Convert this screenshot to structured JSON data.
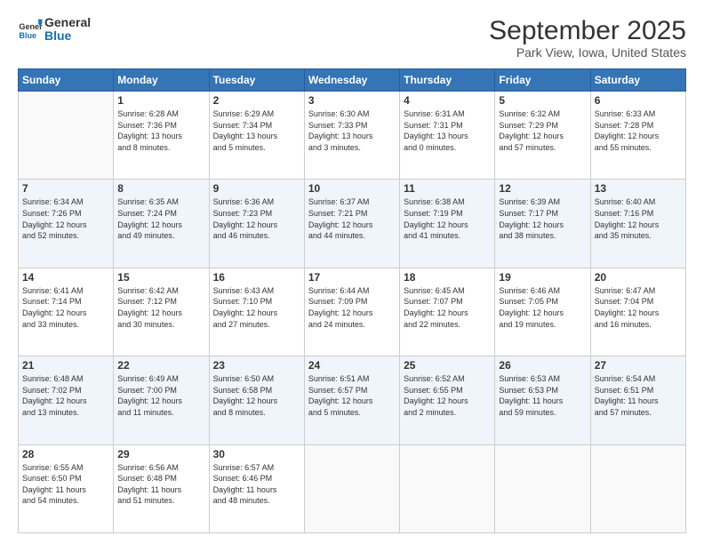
{
  "header": {
    "logo_line1": "General",
    "logo_line2": "Blue",
    "title": "September 2025",
    "subtitle": "Park View, Iowa, United States"
  },
  "days_of_week": [
    "Sunday",
    "Monday",
    "Tuesday",
    "Wednesday",
    "Thursday",
    "Friday",
    "Saturday"
  ],
  "weeks": [
    [
      {
        "day": "",
        "info": ""
      },
      {
        "day": "1",
        "info": "Sunrise: 6:28 AM\nSunset: 7:36 PM\nDaylight: 13 hours\nand 8 minutes."
      },
      {
        "day": "2",
        "info": "Sunrise: 6:29 AM\nSunset: 7:34 PM\nDaylight: 13 hours\nand 5 minutes."
      },
      {
        "day": "3",
        "info": "Sunrise: 6:30 AM\nSunset: 7:33 PM\nDaylight: 13 hours\nand 3 minutes."
      },
      {
        "day": "4",
        "info": "Sunrise: 6:31 AM\nSunset: 7:31 PM\nDaylight: 13 hours\nand 0 minutes."
      },
      {
        "day": "5",
        "info": "Sunrise: 6:32 AM\nSunset: 7:29 PM\nDaylight: 12 hours\nand 57 minutes."
      },
      {
        "day": "6",
        "info": "Sunrise: 6:33 AM\nSunset: 7:28 PM\nDaylight: 12 hours\nand 55 minutes."
      }
    ],
    [
      {
        "day": "7",
        "info": "Sunrise: 6:34 AM\nSunset: 7:26 PM\nDaylight: 12 hours\nand 52 minutes."
      },
      {
        "day": "8",
        "info": "Sunrise: 6:35 AM\nSunset: 7:24 PM\nDaylight: 12 hours\nand 49 minutes."
      },
      {
        "day": "9",
        "info": "Sunrise: 6:36 AM\nSunset: 7:23 PM\nDaylight: 12 hours\nand 46 minutes."
      },
      {
        "day": "10",
        "info": "Sunrise: 6:37 AM\nSunset: 7:21 PM\nDaylight: 12 hours\nand 44 minutes."
      },
      {
        "day": "11",
        "info": "Sunrise: 6:38 AM\nSunset: 7:19 PM\nDaylight: 12 hours\nand 41 minutes."
      },
      {
        "day": "12",
        "info": "Sunrise: 6:39 AM\nSunset: 7:17 PM\nDaylight: 12 hours\nand 38 minutes."
      },
      {
        "day": "13",
        "info": "Sunrise: 6:40 AM\nSunset: 7:16 PM\nDaylight: 12 hours\nand 35 minutes."
      }
    ],
    [
      {
        "day": "14",
        "info": "Sunrise: 6:41 AM\nSunset: 7:14 PM\nDaylight: 12 hours\nand 33 minutes."
      },
      {
        "day": "15",
        "info": "Sunrise: 6:42 AM\nSunset: 7:12 PM\nDaylight: 12 hours\nand 30 minutes."
      },
      {
        "day": "16",
        "info": "Sunrise: 6:43 AM\nSunset: 7:10 PM\nDaylight: 12 hours\nand 27 minutes."
      },
      {
        "day": "17",
        "info": "Sunrise: 6:44 AM\nSunset: 7:09 PM\nDaylight: 12 hours\nand 24 minutes."
      },
      {
        "day": "18",
        "info": "Sunrise: 6:45 AM\nSunset: 7:07 PM\nDaylight: 12 hours\nand 22 minutes."
      },
      {
        "day": "19",
        "info": "Sunrise: 6:46 AM\nSunset: 7:05 PM\nDaylight: 12 hours\nand 19 minutes."
      },
      {
        "day": "20",
        "info": "Sunrise: 6:47 AM\nSunset: 7:04 PM\nDaylight: 12 hours\nand 16 minutes."
      }
    ],
    [
      {
        "day": "21",
        "info": "Sunrise: 6:48 AM\nSunset: 7:02 PM\nDaylight: 12 hours\nand 13 minutes."
      },
      {
        "day": "22",
        "info": "Sunrise: 6:49 AM\nSunset: 7:00 PM\nDaylight: 12 hours\nand 11 minutes."
      },
      {
        "day": "23",
        "info": "Sunrise: 6:50 AM\nSunset: 6:58 PM\nDaylight: 12 hours\nand 8 minutes."
      },
      {
        "day": "24",
        "info": "Sunrise: 6:51 AM\nSunset: 6:57 PM\nDaylight: 12 hours\nand 5 minutes."
      },
      {
        "day": "25",
        "info": "Sunrise: 6:52 AM\nSunset: 6:55 PM\nDaylight: 12 hours\nand 2 minutes."
      },
      {
        "day": "26",
        "info": "Sunrise: 6:53 AM\nSunset: 6:53 PM\nDaylight: 11 hours\nand 59 minutes."
      },
      {
        "day": "27",
        "info": "Sunrise: 6:54 AM\nSunset: 6:51 PM\nDaylight: 11 hours\nand 57 minutes."
      }
    ],
    [
      {
        "day": "28",
        "info": "Sunrise: 6:55 AM\nSunset: 6:50 PM\nDaylight: 11 hours\nand 54 minutes."
      },
      {
        "day": "29",
        "info": "Sunrise: 6:56 AM\nSunset: 6:48 PM\nDaylight: 11 hours\nand 51 minutes."
      },
      {
        "day": "30",
        "info": "Sunrise: 6:57 AM\nSunset: 6:46 PM\nDaylight: 11 hours\nand 48 minutes."
      },
      {
        "day": "",
        "info": ""
      },
      {
        "day": "",
        "info": ""
      },
      {
        "day": "",
        "info": ""
      },
      {
        "day": "",
        "info": ""
      }
    ]
  ]
}
